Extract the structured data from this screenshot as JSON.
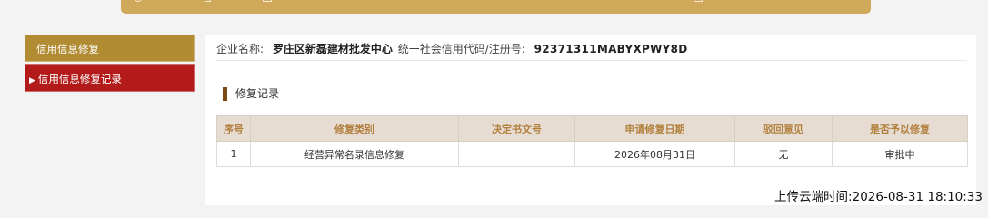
{
  "colors": {
    "top_bar": "#d0a85a",
    "sidebar_active_gold": "#b18c33",
    "sidebar_selected_red": "#b31b1b",
    "table_header_bg": "#e7dcd2",
    "table_header_text": "#b2803d",
    "section_marker": "#7a4a12"
  },
  "sidebar": {
    "items": [
      {
        "label": "信用信息修复"
      },
      {
        "label": "信用信息修复记录",
        "icon": "caret-right-icon"
      }
    ]
  },
  "company": {
    "name_label": "企业名称:",
    "name": "罗庄区新磊建材批发中心",
    "code_label": "统一社会信用代码/注册号:",
    "code": "92371311MABYXPWY8D"
  },
  "section": {
    "title": "修复记录"
  },
  "table": {
    "headers": [
      "序号",
      "修复类别",
      "决定书文号",
      "申请修复日期",
      "驳回意见",
      "是否予以修复"
    ],
    "rows": [
      [
        "1",
        "经营异常名录信息修复",
        "",
        "2026年08月31日",
        "无",
        "审批中"
      ]
    ]
  },
  "footer": {
    "upload_label": "上传云端时间:",
    "upload_time": "2026-08-31 18:10:33"
  }
}
